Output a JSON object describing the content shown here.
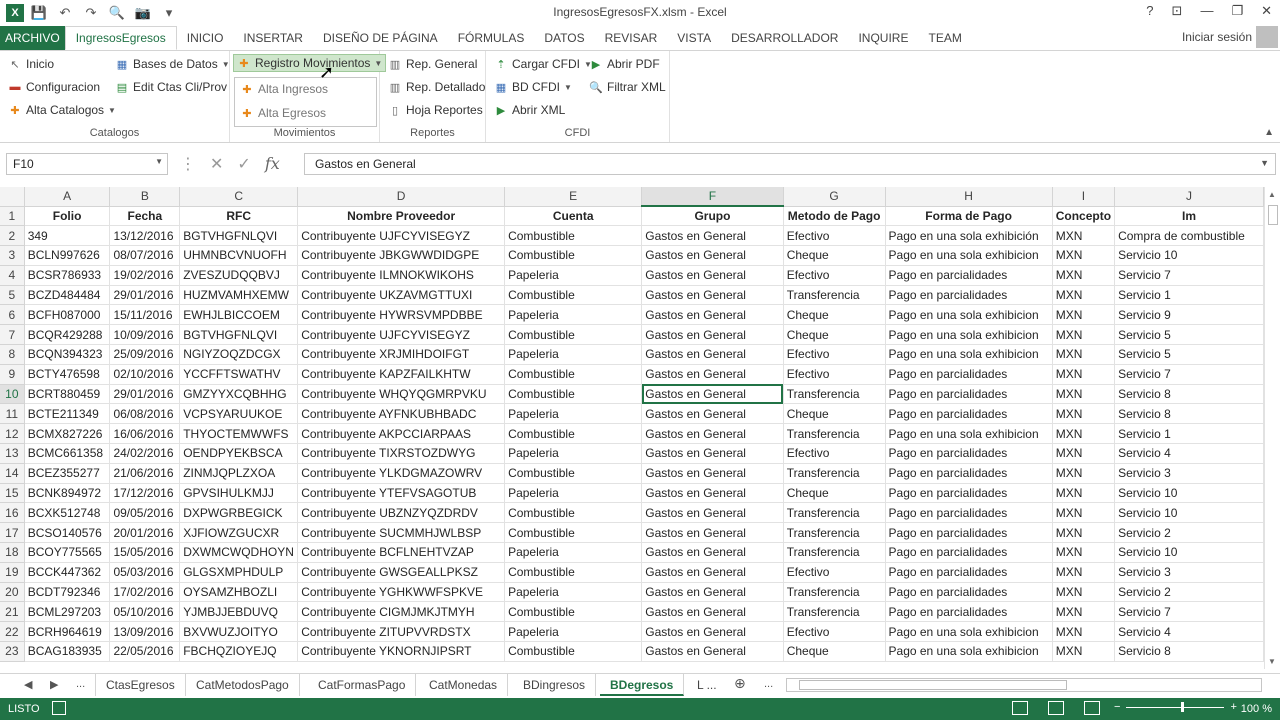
{
  "window": {
    "title": "IngresosEgresosFX.xlsm - Excel",
    "controls": [
      "?",
      "⊡",
      "—",
      "❐",
      "✕"
    ]
  },
  "ribbon_tabs": [
    "ARCHIVO",
    "IngresosEgresos",
    "INICIO",
    "INSERTAR",
    "DISEÑO DE PÁGINA",
    "FÓRMULAS",
    "DATOS",
    "REVISAR",
    "VISTA",
    "DESARROLLADOR",
    "INQUIRE",
    "TEAM"
  ],
  "active_tab": "IngresosEgresos",
  "sign_in": "Iniciar sesión",
  "groups": {
    "catalogos": {
      "label": "Catalogos",
      "inicio": "Inicio",
      "configuracion": "Configuracion",
      "alta_catalogos": "Alta Catalogos",
      "bases_de_datos": "Bases de Datos",
      "edit_ctas": "Edit Ctas Cli/Prov"
    },
    "movimientos": {
      "label": "Movimientos",
      "registro": "Registro Movimientos",
      "alta_ingresos": "Alta Ingresos",
      "alta_egresos": "Alta Egresos"
    },
    "reportes": {
      "label": "Reportes",
      "rep_general": "Rep. General",
      "rep_detallado": "Rep. Detallado",
      "hoja_reportes": "Hoja Reportes"
    },
    "cfdi": {
      "label": "CFDI",
      "cargar_cfdi": "Cargar CFDI",
      "bd_cfdi": "BD CFDI",
      "abrir_xml": "Abrir XML",
      "abrir_pdf": "Abrir PDF",
      "filtrar_xml": "Filtrar XML"
    }
  },
  "formula_bar": {
    "name_box": "F10",
    "formula": "Gastos en General"
  },
  "columns": [
    "A",
    "B",
    "C",
    "D",
    "E",
    "F",
    "G",
    "H",
    "I",
    "J"
  ],
  "header_row": [
    "Folio",
    "Fecha",
    "RFC",
    "Nombre Proveedor",
    "Cuenta",
    "Grupo",
    "Metodo de Pago",
    "Forma de Pago",
    "Concepto",
    "Im"
  ],
  "rows": [
    [
      "349",
      "13/12/2016",
      "BGTVHGFNLQVI",
      "Contribuyente UJFCYVISEGYZ",
      "Combustible",
      "Gastos en General",
      "Efectivo",
      "Pago en una sola exhibición",
      "MXN",
      "Compra de combustible"
    ],
    [
      "BCLN997626",
      "08/07/2016",
      "UHMNBCVNUOFH",
      "Contribuyente JBKGWWDIDGPE",
      "Combustible",
      "Gastos en General",
      "Cheque",
      "Pago en una sola exhibicion",
      "MXN",
      "Servicio 10"
    ],
    [
      "BCSR786933",
      "19/02/2016",
      "ZVESZUDQQBVJ",
      "Contribuyente ILMNOKWIKOHS",
      "Papeleria",
      "Gastos en General",
      "Efectivo",
      "Pago en parcialidades",
      "MXN",
      "Servicio 7"
    ],
    [
      "BCZD484484",
      "29/01/2016",
      "HUZMVAMHXEMW",
      "Contribuyente UKZAVMGTTUXI",
      "Combustible",
      "Gastos en General",
      "Transferencia",
      "Pago en parcialidades",
      "MXN",
      "Servicio 1"
    ],
    [
      "BCFH087000",
      "15/11/2016",
      "EWHJLBICCOEM",
      "Contribuyente HYWRSVMPDBBE",
      "Papeleria",
      "Gastos en General",
      "Cheque",
      "Pago en una sola exhibicion",
      "MXN",
      "Servicio 9"
    ],
    [
      "BCQR429288",
      "10/09/2016",
      "BGTVHGFNLQVI",
      "Contribuyente UJFCYVISEGYZ",
      "Combustible",
      "Gastos en General",
      "Cheque",
      "Pago en una sola exhibicion",
      "MXN",
      "Servicio 5"
    ],
    [
      "BCQN394323",
      "25/09/2016",
      "NGIYZOQZDCGX",
      "Contribuyente XRJMIHDOIFGT",
      "Papeleria",
      "Gastos en General",
      "Efectivo",
      "Pago en una sola exhibicion",
      "MXN",
      "Servicio 5"
    ],
    [
      "BCTY476598",
      "02/10/2016",
      "YCCFFTSWATHV",
      "Contribuyente KAPZFAILKHTW",
      "Combustible",
      "Gastos en General",
      "Efectivo",
      "Pago en parcialidades",
      "MXN",
      "Servicio 7"
    ],
    [
      "BCRT880459",
      "29/01/2016",
      "GMZYYXCQBHHG",
      "Contribuyente WHQYQGMRPVKU",
      "Combustible",
      "Gastos en General",
      "Transferencia",
      "Pago en parcialidades",
      "MXN",
      "Servicio 8"
    ],
    [
      "BCTE211349",
      "06/08/2016",
      "VCPSYARUUKOE",
      "Contribuyente AYFNKUBHBADC",
      "Papeleria",
      "Gastos en General",
      "Cheque",
      "Pago en parcialidades",
      "MXN",
      "Servicio 8"
    ],
    [
      "BCMX827226",
      "16/06/2016",
      "THYOCTEMWWFS",
      "Contribuyente AKPCCIARPAAS",
      "Combustible",
      "Gastos en General",
      "Transferencia",
      "Pago en una sola exhibicion",
      "MXN",
      "Servicio 1"
    ],
    [
      "BCMC661358",
      "24/02/2016",
      "OENDPYEKBSCA",
      "Contribuyente TIXRSTOZDWYG",
      "Papeleria",
      "Gastos en General",
      "Efectivo",
      "Pago en parcialidades",
      "MXN",
      "Servicio 4"
    ],
    [
      "BCEZ355277",
      "21/06/2016",
      "ZINMJQPLZXOA",
      "Contribuyente YLKDGMAZOWRV",
      "Combustible",
      "Gastos en General",
      "Transferencia",
      "Pago en parcialidades",
      "MXN",
      "Servicio 3"
    ],
    [
      "BCNK894972",
      "17/12/2016",
      "GPVSIHULKMJJ",
      "Contribuyente YTEFVSAGOTUB",
      "Papeleria",
      "Gastos en General",
      "Cheque",
      "Pago en parcialidades",
      "MXN",
      "Servicio 10"
    ],
    [
      "BCXK512748",
      "09/05/2016",
      "DXPWGRBEGICK",
      "Contribuyente UBZNZYQZDRDV",
      "Combustible",
      "Gastos en General",
      "Transferencia",
      "Pago en parcialidades",
      "MXN",
      "Servicio 10"
    ],
    [
      "BCSO140576",
      "20/01/2016",
      "XJFIOWZGUCXR",
      "Contribuyente SUCMMHJWLBSP",
      "Combustible",
      "Gastos en General",
      "Transferencia",
      "Pago en parcialidades",
      "MXN",
      "Servicio 2"
    ],
    [
      "BCOY775565",
      "15/05/2016",
      "DXWMCWQDHOYN",
      "Contribuyente BCFLNEHTVZAP",
      "Papeleria",
      "Gastos en General",
      "Transferencia",
      "Pago en parcialidades",
      "MXN",
      "Servicio 10"
    ],
    [
      "BCCK447362",
      "05/03/2016",
      "GLGSXMPHDULP",
      "Contribuyente GWSGEALLPKSZ",
      "Combustible",
      "Gastos en General",
      "Efectivo",
      "Pago en parcialidades",
      "MXN",
      "Servicio 3"
    ],
    [
      "BCDT792346",
      "17/02/2016",
      "OYSAMZHBOZLI",
      "Contribuyente YGHKWWFSPKVE",
      "Papeleria",
      "Gastos en General",
      "Transferencia",
      "Pago en parcialidades",
      "MXN",
      "Servicio 2"
    ],
    [
      "BCML297203",
      "05/10/2016",
      "YJMBJJEBDUVQ",
      "Contribuyente CIGMJMKJTMYH",
      "Combustible",
      "Gastos en General",
      "Transferencia",
      "Pago en parcialidades",
      "MXN",
      "Servicio 7"
    ],
    [
      "BCRH964619",
      "13/09/2016",
      "BXVWUZJOITYO",
      "Contribuyente ZITUPVVRDSTX",
      "Papeleria",
      "Gastos en General",
      "Efectivo",
      "Pago en una sola exhibicion",
      "MXN",
      "Servicio 4"
    ],
    [
      "BCAG183935",
      "22/05/2016",
      "FBCHQZIOYEJQ",
      "Contribuyente YKNORNJIPSRT",
      "Combustible",
      "Gastos en General",
      "Cheque",
      "Pago en una sola exhibicion",
      "MXN",
      "Servicio 8"
    ]
  ],
  "selected_cell": {
    "row": 10,
    "col": "F"
  },
  "sheet_tabs": [
    "...",
    "CtasEgresos",
    "CatMetodosPago",
    "CatFormasPago",
    "CatMonedas",
    "BDingresos",
    "BDegresos",
    "L ...",
    "..."
  ],
  "active_sheet": "BDegresos",
  "status": {
    "ready": "LISTO",
    "zoom": "100 %",
    "zoom_minus": "−",
    "zoom_plus": "+"
  },
  "colors": {
    "accent": "#217346",
    "selection": "#e1e1e1"
  }
}
